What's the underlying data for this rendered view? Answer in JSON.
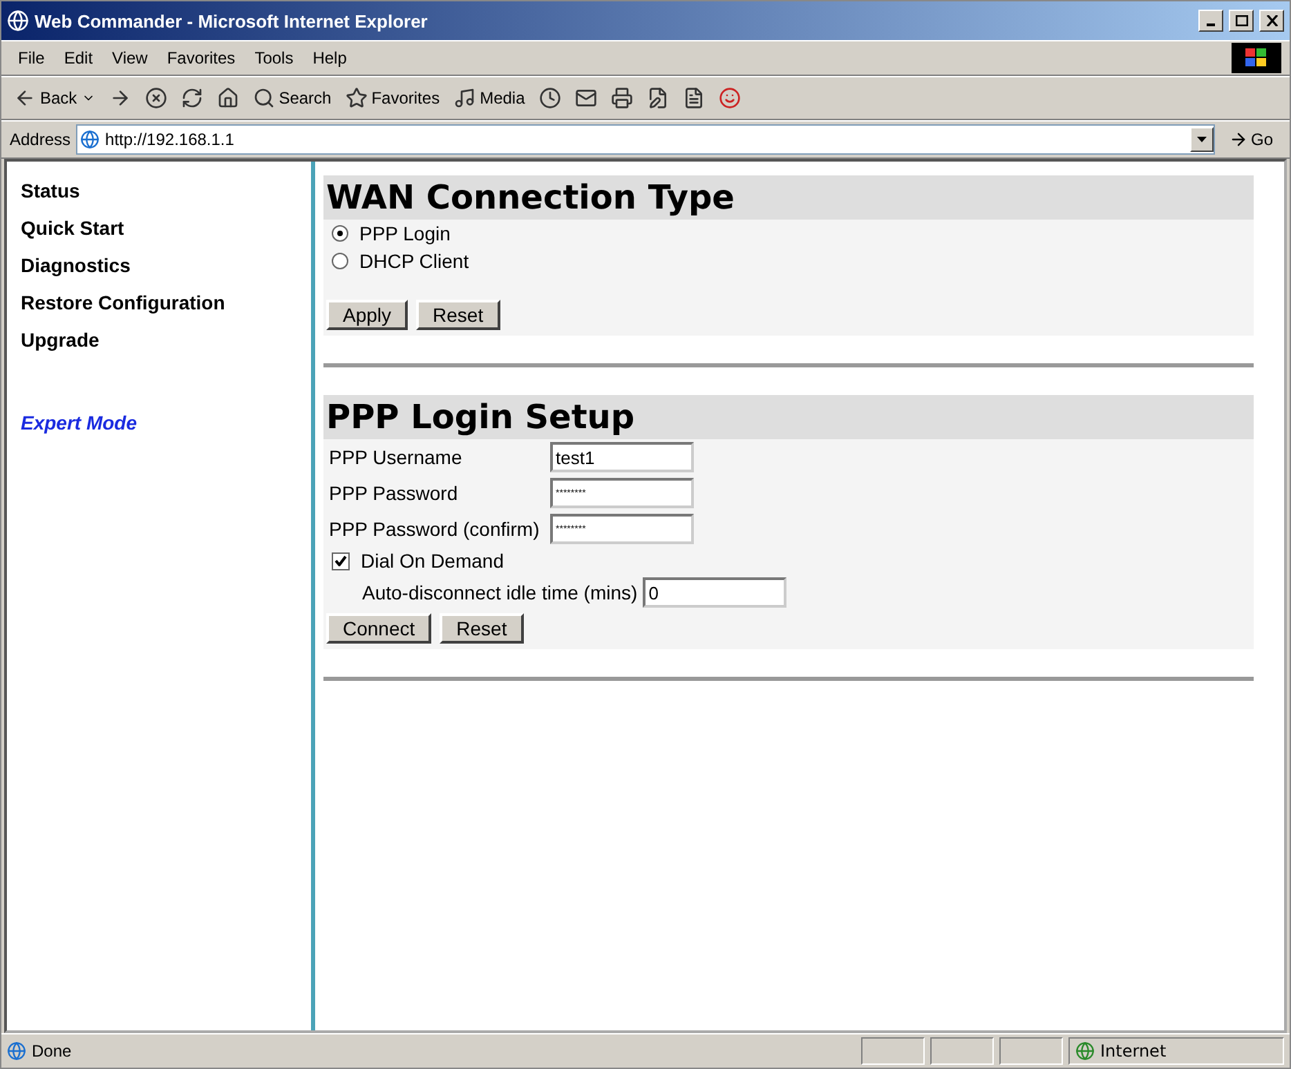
{
  "window": {
    "title": "Web Commander - Microsoft Internet Explorer"
  },
  "menu": [
    "File",
    "Edit",
    "View",
    "Favorites",
    "Tools",
    "Help"
  ],
  "toolbar": [
    {
      "kind": "back",
      "label": "Back"
    },
    {
      "kind": "forward"
    },
    {
      "kind": "stop"
    },
    {
      "kind": "refresh"
    },
    {
      "kind": "home"
    },
    {
      "kind": "search",
      "label": "Search"
    },
    {
      "kind": "favorites",
      "label": "Favorites"
    },
    {
      "kind": "media",
      "label": "Media"
    },
    {
      "kind": "history"
    },
    {
      "kind": "mail"
    },
    {
      "kind": "print"
    },
    {
      "kind": "edit"
    },
    {
      "kind": "discuss"
    },
    {
      "kind": "messenger"
    }
  ],
  "address": {
    "label": "Address",
    "value": "http://192.168.1.1",
    "go": "Go"
  },
  "sidebar": {
    "items": [
      {
        "label": "Status"
      },
      {
        "label": "Quick Start"
      },
      {
        "label": "Diagnostics"
      },
      {
        "label": "Restore Configuration"
      },
      {
        "label": "Upgrade"
      }
    ],
    "expert_link": "Expert Mode"
  },
  "wan": {
    "title": "WAN Connection Type",
    "options": [
      {
        "label": "PPP Login",
        "selected": true
      },
      {
        "label": "DHCP Client",
        "selected": false
      }
    ],
    "buttons": [
      "Apply",
      "Reset"
    ]
  },
  "ppp": {
    "title": "PPP Login Setup",
    "fields": [
      {
        "label": "PPP Username",
        "value": "test1",
        "kind": "text"
      },
      {
        "label": "PPP Password",
        "value": "********",
        "kind": "password"
      },
      {
        "label": "PPP Password (confirm)",
        "value": "********",
        "kind": "password"
      }
    ],
    "dial_on_demand": {
      "label": "Dial On Demand",
      "checked": true
    },
    "idle": {
      "label": "Auto-disconnect idle time (mins)",
      "value": "0"
    },
    "buttons": [
      "Connect",
      "Reset"
    ]
  },
  "status_bar": {
    "text": "Done",
    "zone": "Internet"
  }
}
